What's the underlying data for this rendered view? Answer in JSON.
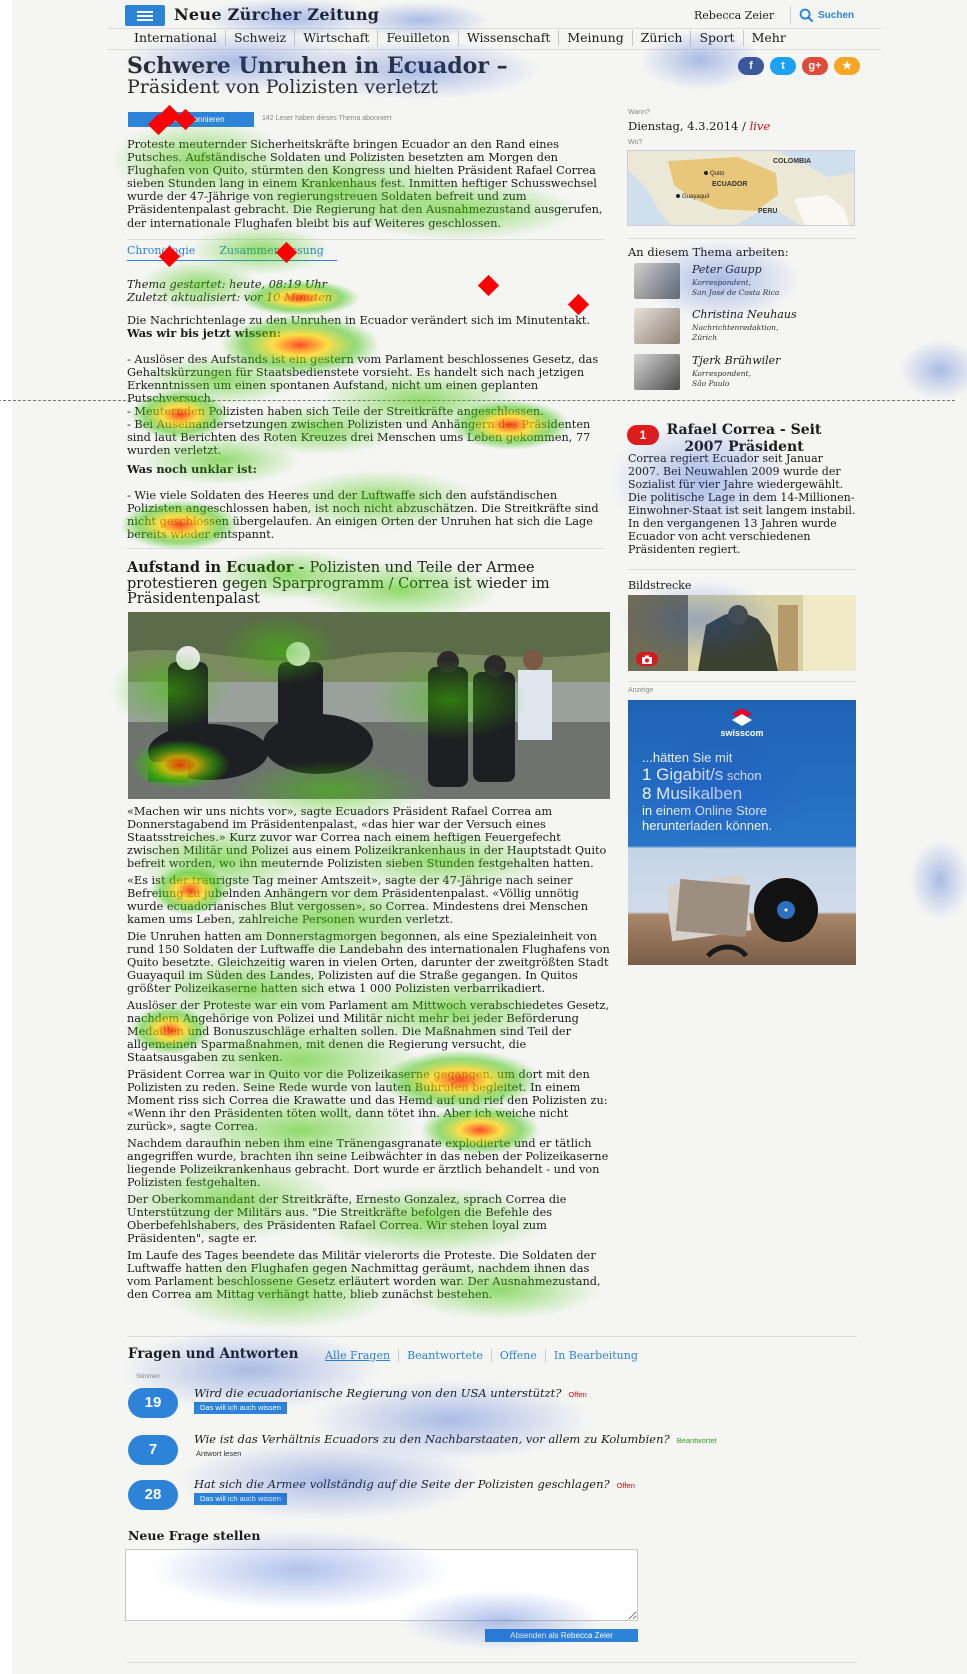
{
  "header": {
    "logo": "Neue Zürcher Zeitung",
    "user": "Rebecca Zeier",
    "search_label": "Suchen",
    "nav": [
      "International",
      "Schweiz",
      "Wirtschaft",
      "Feuilleton",
      "Wissenschaft",
      "Meinung",
      "Zürich",
      "Sport",
      "Mehr"
    ]
  },
  "article": {
    "title": "Schwere Unruhen in Ecuador –",
    "subtitle": "Präsident von Polizisten verletzt",
    "follow_button": "Thema abonnieren",
    "follow_info": "142 Leser haben dieses Thema abonniert",
    "intro": "Proteste meuternder Sicherheitskräfte bringen Ecuador an den Rand eines Putsches. Aufständische Soldaten und Polizisten besetzten am Morgen den Flughafen von Quito, stürmten den Kongress und hielten Präsident Rafael Correa sieben Stunden lang in einem Krankenhaus fest. Inmitten heftiger Schusswechsel wurde der 47-Jährige von regierungstreuen Soldaten befreit und zum Präsidentenpalast gebracht. Die Regierung hat den Ausnahmezustand ausgerufen, der internationale Flughafen bleibt bis auf Weiteres geschlossen.",
    "tabs": [
      "Chronologie",
      "Zusammenfassung"
    ],
    "meta_started": "Thema gestartet: heute, 08:19 Uhr",
    "meta_updated": "Zuletzt aktualisiert: vor 10 Minuten",
    "lead": "Die Nachrichtenlage zu den Unruhen in Ecuador verändert sich im Minutentakt.",
    "lead_bold": "Was wir bis jetzt wissen:",
    "known_1": "- Auslöser des Aufstands ist ein gestern vom Parlament beschlossenes Gesetz, das Gehaltskürzungen für Staatsbedienstete vorsieht. Es handelt sich nach jetzigen Erkenntnissen um einen spontanen Aufstand, nicht um einen geplanten Putschversuch.",
    "known_2": "- Meuternden Polizisten haben sich Teile der Streitkräfte angeschlossen.",
    "known_3": "- Bei Auseinandersetzungen zwischen Polizisten und Anhängern des Präsidenten sind laut Berichten des Roten Kreuzes drei Menschen ums Leben gekommen, 77 wurden verletzt.",
    "unclear_title": "Was noch unklar ist:",
    "unclear_1": "- Wie viele Soldaten des Heeres und der Luftwaffe sich den aufständischen Polizisten angeschlossen haben, ist noch nicht abzuschätzen. Die Streitkräfte sind nicht geschlossen übergelaufen. An einigen Orten der Unruhen hat sich die Lage bereits wieder entspannt.",
    "section2_bold": "Aufstand in Ecuador - ",
    "section2_title": "Polizisten und Teile der Armee protestieren gegen Sparprogramm / Correa ist wieder im Präsidentenpalast",
    "paragraphs": [
      "«Machen wir uns nichts vor», sagte Ecuadors Präsident Rafael Correa am Donnerstagabend im Präsidentenpalast, «das hier war der Versuch eines Staatsstreiches.» Kurz zuvor war Correa nach einem heftigen Feuergefecht zwischen Militär und Polizei aus einem Polizeikrankenhaus in der Hauptstadt Quito befreit worden, wo ihn meuternde Polizisten sieben Stunden festgehalten hatten.",
      "«Es ist der traurigste Tag meiner Amtszeit», sagte der 47-Jährige nach seiner Befreiung zu jubelnden Anhängern vor dem Präsidentenpalast. «Völlig unnötig wurde ecuadorianisches Blut vergossen», so Correa. Mindestens drei Menschen kamen ums Leben, zahlreiche Personen wurden verletzt.",
      "Die Unruhen hatten am Donnerstagmorgen begonnen, als eine Spezialeinheit von rund 150 Soldaten der Luftwaffe die Landebahn des internationalen Flughafens von Quito besetzte. Gleichzeitig waren in vielen Orten, darunter der zweitgrößten Stadt Guayaquil im Süden des Landes, Polizisten auf die Straße gegangen. In Quitos größter Polizeikaserne hatten sich etwa 1 000 Polizisten verbarrikadiert.",
      "Auslöser der Proteste war ein vom Parlament am Mittwoch verabschiedetes Gesetz, nachdem Angehörige von Polizei und Militär nicht mehr bei jeder Beförderung Medaillen und Bonuszuschläge erhalten sollen. Die Maßnahmen sind Teil der allgemeinen Sparmaßnahmen, mit denen die Regierung versucht, die Staatsausgaben zu senken.",
      "Präsident Correa war in Quito vor die Polizeikaserne gegangen, um dort mit den Polizisten zu reden. Seine Rede wurde von lauten Buhrufen begleitet. In einem Moment riss sich Correa die Krawatte und das Hemd auf und rief den Polizisten zu: «Wenn ihr den Präsidenten töten wollt, dann tötet ihn. Aber ich weiche nicht zurück», sagte Correa.",
      "Nachdem daraufhin neben ihm eine Tränengasgranate explodierte und er tätlich angegriffen wurde, brachten ihn seine Leibwächter in das neben der Polizeikaserne liegende Polizeikrankenhaus gebracht. Dort wurde er ärztlich behandelt - und von Polizisten festgehalten.",
      "Der Oberkommandant der Streitkräfte, Ernesto Gonzalez, sprach Correa die Unterstützung der Militärs aus. \"Die Streitkräfte befolgen die Befehle des Oberbefehlshabers, des Präsidenten Rafael Correa. Wir stehen loyal zum Präsidenten\", sagte er.",
      "Im Laufe des Tages beendete das Militär vielerorts die Proteste. Die Soldaten der Luftwaffe hatten den Flughafen gegen Nachmittag geräumt, nachdem ihnen das vom Parlament beschlossene Gesetz erläutert worden war. Der Ausnahmezustand, den Correa am Mittag verhängt hatte, blieb zunächst bestehen."
    ]
  },
  "sidebar": {
    "when_label": "Wann?",
    "when_date": "Dienstag, 4.3.2014 / ",
    "when_live": "live",
    "where_label": "Wo?",
    "map_labels": [
      "COLOMBIA",
      "Quito",
      "ECUADOR",
      "Guayaquil",
      "PERU"
    ],
    "authors_title": "An diesem Thema arbeiten:",
    "authors": [
      {
        "name": "Peter Gaupp",
        "role1": "Korrespondent,",
        "role2": "San José de Costa Rica"
      },
      {
        "name": "Christina Neuhaus",
        "role1": "Nachrichtenredaktion,",
        "role2": "Zürich"
      },
      {
        "name": "Tjerk Brühwiler",
        "role1": "Korrespondent,",
        "role2": "São Paulo"
      }
    ],
    "correa_badge": "1",
    "correa_title": "Rafael Correa - Seit 2007 Präsident",
    "correa_text": "Correa regiert Ecuador seit Januar 2007. Bei Neuwahlen 2009 wurde der Sozialist für vier Jahre wiedergewählt. Die politische Lage in dem 14-Millionen-Einwohner-Staat ist seit langem instabil. In den vergangenen 13 Jahren wurde Ecuador von acht verschiedenen Präsidenten regiert.",
    "gallery_title": "Bildstrecke",
    "ad_label": "Anzeige",
    "ad_brand": "swisscom",
    "ad_line1": "...hätten Sie mit",
    "ad_line2": "1 Gigabit/s",
    "ad_line2b": " schon",
    "ad_line3": "8 Musikalben",
    "ad_line4": "in einem Online Store",
    "ad_line5": "herunterladen können."
  },
  "qa": {
    "title": "Fragen und Antworten",
    "tabs": [
      "Alle Fragen",
      "Beantwortete",
      "Offene",
      "In Bearbeitung"
    ],
    "votes_label": "Stimmen",
    "questions": [
      {
        "count": "19",
        "text": "Wird die ecuadorianische Regierung von den USA unterstützt?",
        "status": "Offen",
        "action": "Das will ich auch wissen"
      },
      {
        "count": "7",
        "text": "Wie ist das Verhältnis Ecuadors zu den Nachbarstaaten, vor allem zu Kolumbien?",
        "status": "Beantwortet",
        "action": "Antwort lesen"
      },
      {
        "count": "28",
        "text": "Hat sich die Armee vollständig auf die Seite der Polizisten geschlagen?",
        "status": "Offen",
        "action": "Das will ich auch wissen"
      }
    ],
    "new_title": "Neue Frage stellen",
    "submit": "Absenden als Rebecca Zeier"
  },
  "colors": {
    "accent": "#2c83d8",
    "live": "#c41010",
    "open": "#d01010",
    "answered": "#3a9a2a",
    "background": "#f5f5f4"
  }
}
